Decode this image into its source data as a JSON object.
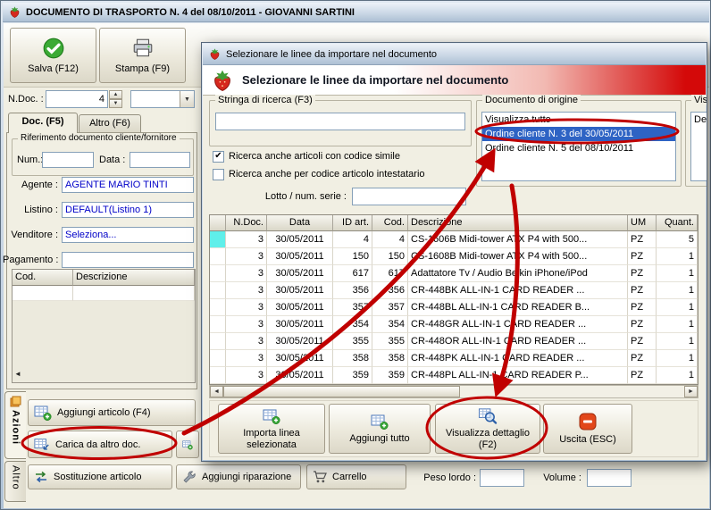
{
  "colors": {
    "annotation_red": "#c00000",
    "selection_blue": "#2e63c4",
    "header_red": "#d40909",
    "value_blue": "#0000c8"
  },
  "icons": {
    "check_mark": "✔",
    "spinner_up": "▲",
    "spinner_down": "▼",
    "dropdown_arrow": "▼",
    "scroll_left": "◄",
    "scroll_right": "►",
    "grid_scroll_left": "◄"
  },
  "main": {
    "title": "DOCUMENTO DI TRASPORTO N. 4  del 08/10/2011 - GIOVANNI SARTINI",
    "save_label": "Salva (F12)",
    "print_label": "Stampa (F9)",
    "ndoc_label": "N.Doc. :",
    "ndoc_value": "4",
    "tab_doc": "Doc. (F5)",
    "tab_altro": "Altro (F6)",
    "rif_title": "Riferimento documento cliente/fornitore",
    "num_label": "Num.:",
    "data_label": "Data :",
    "agente_label": "Agente :",
    "agente_value": "AGENTE MARIO TINTI",
    "listino_label": "Listino :",
    "listino_value": "DEFAULT(Listino 1)",
    "venditore_label": "Venditore :",
    "venditore_value": "Seleziona...",
    "pagamento_label": "Pagamento :",
    "grid_col_cod": "Cod.",
    "grid_col_descrizione": "Descrizione",
    "side_tab_azioni": "Azioni",
    "side_tab_altro": "Altro",
    "btn_aggiungi_articolo": "Aggiungi articolo (F4)",
    "btn_carica_da_altro": "Carica da altro doc.",
    "btn_sostituzione": "Sostituzione articolo",
    "btn_riparazione": "Aggiungi riparazione",
    "btn_carrello": "Carrello",
    "peso_label": "Peso lordo :",
    "volume_label": "Volume :"
  },
  "dialog": {
    "title": "Selezionare le linee da importare nel documento",
    "header_title": "Selezionare le linee da importare nel documento",
    "search_title": "Stringa di ricerca (F3)",
    "search_value": "",
    "chk_simile_label": "Ricerca anche articoli con codice simile",
    "chk_simile_checked": true,
    "chk_intestatario_label": "Ricerca anche per codice articolo intestatario",
    "chk_intestatario_checked": false,
    "lotto_label": "Lotto / num. serie :",
    "lotto_value": "",
    "origin_title": "Documento di origine",
    "origin_items": [
      "Visualizza tutto",
      "Ordine cliente N. 3 del 30/05/2011",
      "Ordine cliente N. 5 del 08/10/2011"
    ],
    "origin_selected_index": 1,
    "vis_title": "Vis",
    "vis_item": "De",
    "table": {
      "columns": [
        "",
        "N.Doc.",
        "Data",
        "ID art.",
        "Cod.",
        "Descrizione",
        "UM",
        "Quant."
      ],
      "rows": [
        [
          "",
          "3",
          "30/05/2011",
          "4",
          "4",
          "CS-1606B Midi-tower ATX P4 with 500...",
          "PZ",
          "5"
        ],
        [
          "",
          "3",
          "30/05/2011",
          "150",
          "150",
          "CS-1608B Midi-tower ATX P4 with 500...",
          "PZ",
          "1"
        ],
        [
          "",
          "3",
          "30/05/2011",
          "617",
          "617",
          "Adattatore Tv / Audio Belkin iPhone/iPod",
          "PZ",
          "1"
        ],
        [
          "",
          "3",
          "30/05/2011",
          "356",
          "356",
          "CR-448BK ALL-IN-1 CARD READER ...",
          "PZ",
          "1"
        ],
        [
          "",
          "3",
          "30/05/2011",
          "357",
          "357",
          "CR-448BL ALL-IN-1 CARD READER B...",
          "PZ",
          "1"
        ],
        [
          "",
          "3",
          "30/05/2011",
          "354",
          "354",
          "CR-448GR ALL-IN-1 CARD READER ...",
          "PZ",
          "1"
        ],
        [
          "",
          "3",
          "30/05/2011",
          "355",
          "355",
          "CR-448OR ALL-IN-1 CARD READER ...",
          "PZ",
          "1"
        ],
        [
          "",
          "3",
          "30/05/2011",
          "358",
          "358",
          "CR-448PK ALL-IN-1 CARD READER ...",
          "PZ",
          "1"
        ],
        [
          "",
          "3",
          "30/05/2011",
          "359",
          "359",
          "CR-448PL ALL-IN-1 CARD READER P...",
          "PZ",
          "1"
        ]
      ]
    },
    "btn_importa": "Importa linea selezionata",
    "btn_aggiungi_tutto": "Aggiungi tutto",
    "btn_visualizza": "Visualizza dettaglio (F2)",
    "btn_uscita": "Uscita (ESC)"
  }
}
